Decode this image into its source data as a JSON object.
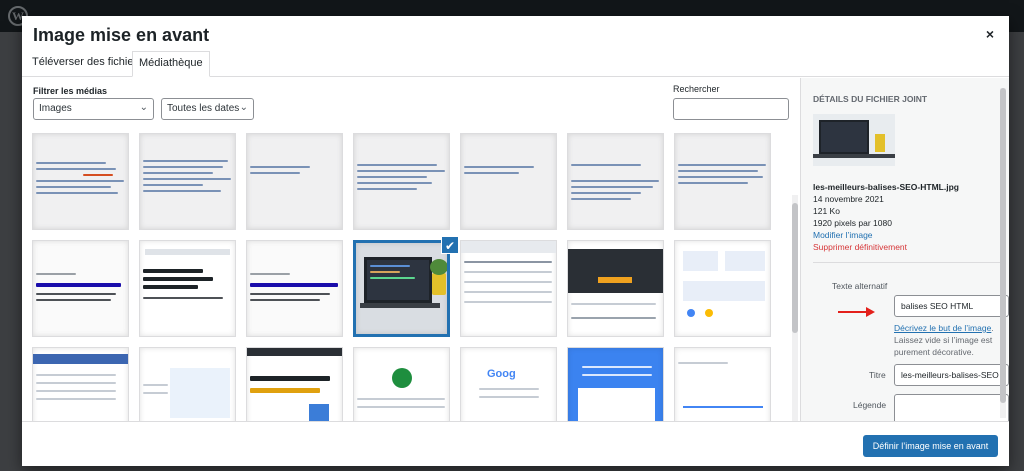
{
  "modal": {
    "title": "Image mise en avant",
    "close_glyph": "×"
  },
  "tabs": [
    {
      "label": "Téléverser des fichiers",
      "active": false
    },
    {
      "label": "Médiathèque",
      "active": true
    }
  ],
  "filters": {
    "label": "Filtrer les médias",
    "type_select": "Images",
    "date_select": "Toutes les dates",
    "search_label": "Rechercher",
    "search_value": ""
  },
  "grid": {
    "selected_index": 10,
    "check_glyph": "✔"
  },
  "sidebar": {
    "heading": "Détails du fichier joint",
    "filename": "les-meilleurs-balises-SEO-HTML.jpg",
    "date": "14 novembre 2021",
    "size": "121 Ko",
    "dimensions": "1920 pixels par 1080",
    "edit_link": "Modifier l’image",
    "delete_link": "Supprimer définitivement",
    "alt_label": "Texte alternatif",
    "alt_value": "balises SEO HTML",
    "alt_help_link": "Décrivez le but de l’image",
    "alt_help_text": ". Laissez vide si l’image est purement décorative.",
    "title_label": "Titre",
    "title_value": "les-meilleurs-balises-SEO",
    "caption_label": "Légende"
  },
  "toolbar": {
    "primary_label": "Définir l’image mise en avant"
  },
  "colors": {
    "accent": "#2271b1",
    "danger": "#d63638",
    "arrow": "#e3201b"
  }
}
